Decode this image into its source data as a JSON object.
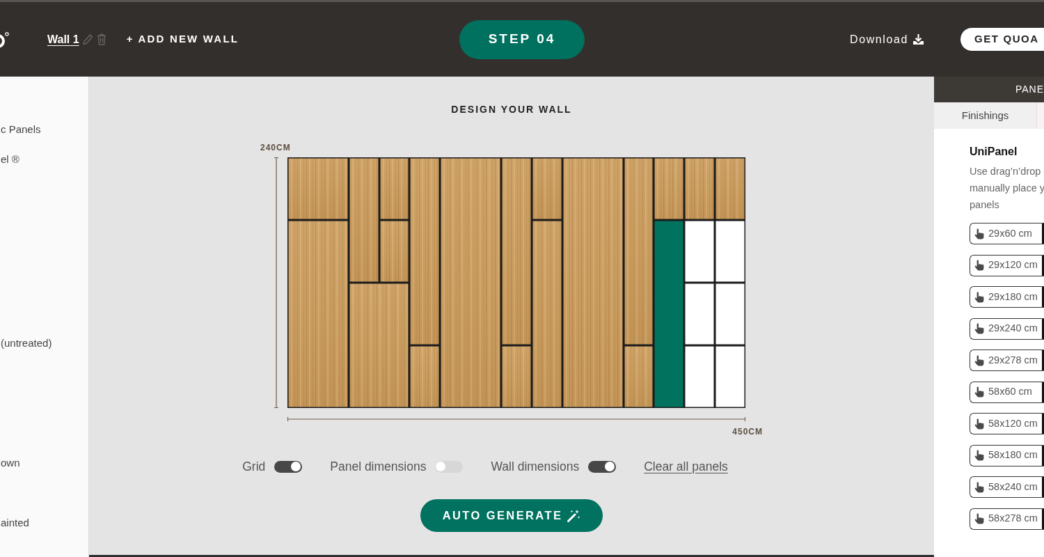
{
  "header": {
    "wall_tab": {
      "label": "Wall 1"
    },
    "add_wall": {
      "label": "+ ADD NEW WALL"
    },
    "step": {
      "label": "STEP 04"
    },
    "download": {
      "label": "Download"
    },
    "quote_button": {
      "label": "GET QUOA"
    }
  },
  "sidebar": {
    "items": [
      {
        "label": "c Panels"
      },
      {
        "label": "el ®"
      },
      {
        "label": "(untreated)"
      },
      {
        "label": "own"
      },
      {
        "label": "ainted"
      }
    ]
  },
  "designer": {
    "title": "DESIGN YOUR WALL",
    "wall_height": "240CM",
    "wall_width": "450CM",
    "panels": [
      {
        "kind": "wood"
      },
      {
        "kind": "wood"
      },
      {
        "kind": "wood"
      },
      {
        "kind": "wood"
      },
      {
        "kind": "wood"
      },
      {
        "kind": "wood"
      },
      {
        "kind": "wood"
      },
      {
        "kind": "wood"
      },
      {
        "kind": "wood"
      },
      {
        "kind": "wood"
      },
      {
        "kind": "wood"
      },
      {
        "kind": "wood"
      },
      {
        "kind": "wood"
      },
      {
        "kind": "wood"
      },
      {
        "kind": "wood"
      },
      {
        "kind": "wood"
      },
      {
        "kind": "wood"
      },
      {
        "kind": "highlighted"
      },
      {
        "kind": "wood"
      },
      {
        "kind": "empty"
      },
      {
        "kind": "empty"
      },
      {
        "kind": "empty"
      },
      {
        "kind": "wood"
      },
      {
        "kind": "empty"
      },
      {
        "kind": "empty"
      },
      {
        "kind": "empty"
      }
    ],
    "grid_toggle": {
      "label": "Grid",
      "on": true
    },
    "panel_dimensions_toggle": {
      "label": "Panel dimensions",
      "on": false
    },
    "wall_dimensions_toggle": {
      "label": "Wall dimensions",
      "on": true
    },
    "clear_link": {
      "label": "Clear all panels"
    },
    "auto_generate": {
      "label": "AUTO GENERATE"
    }
  },
  "panel_library": {
    "header": "PANE",
    "tabs": [
      {
        "label": "Finishings",
        "selected": false
      }
    ],
    "title": "UniPanel",
    "description": "Use drag’n’drop\nmanually place y\npanels",
    "sizes": [
      "29x60 cm",
      "29x120 cm",
      "29x180 cm",
      "29x240 cm",
      "29x278 cm",
      "58x60 cm",
      "58x120 cm",
      "58x180 cm",
      "58x240 cm",
      "58x278 cm"
    ]
  }
}
